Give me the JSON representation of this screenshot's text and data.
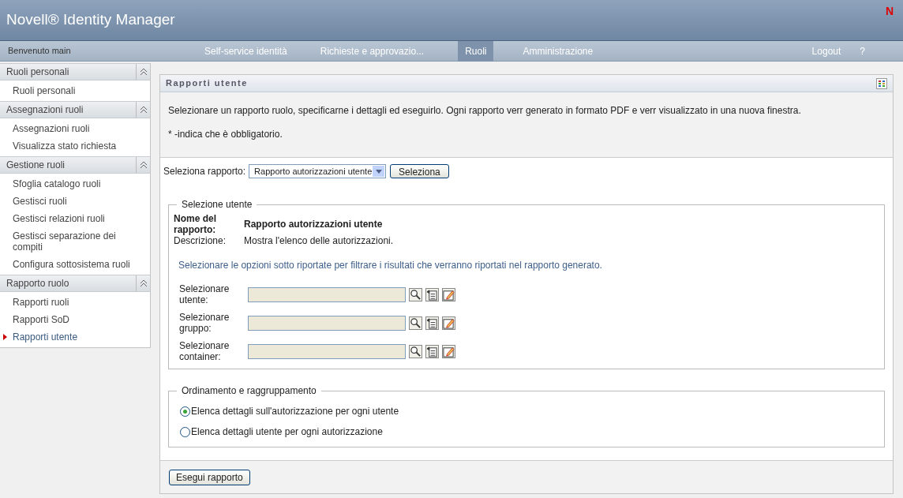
{
  "header": {
    "logo": "Novell® Identity Manager",
    "brand_mark": "N"
  },
  "navbar": {
    "welcome": "Benvenuto main",
    "tabs": [
      {
        "label": "Self-service identità",
        "selected": false
      },
      {
        "label": "Richieste e approvazio...",
        "selected": false
      },
      {
        "label": "Ruoli",
        "selected": true
      },
      {
        "label": "Amministrazione",
        "selected": false
      }
    ],
    "links": [
      "Logout",
      "?"
    ]
  },
  "sidebar": [
    {
      "title": "Ruoli personali",
      "expanded": true,
      "items": [
        {
          "label": "Ruoli personali",
          "selected": false
        }
      ]
    },
    {
      "title": "Assegnazioni ruoli",
      "expanded": true,
      "items": [
        {
          "label": "Assegnazioni ruoli",
          "selected": false
        },
        {
          "label": "Visualizza stato richiesta",
          "selected": false
        }
      ]
    },
    {
      "title": "Gestione ruoli",
      "expanded": true,
      "items": [
        {
          "label": "Sfoglia catalogo ruoli",
          "selected": false
        },
        {
          "label": "Gestisci ruoli",
          "selected": false
        },
        {
          "label": "Gestisci relazioni ruoli",
          "selected": false
        },
        {
          "label": "Gestisci separazione dei compiti",
          "selected": false
        },
        {
          "label": "Configura sottosistema ruoli",
          "selected": false
        }
      ]
    },
    {
      "title": "Rapporto ruolo",
      "expanded": true,
      "items": [
        {
          "label": "Rapporti ruoli",
          "selected": false
        },
        {
          "label": "Rapporti SoD",
          "selected": false
        },
        {
          "label": "Rapporti utente",
          "selected": true
        }
      ]
    }
  ],
  "panel": {
    "title": "Rapporti utente",
    "intro": "Selezionare un rapporto ruolo, specificarne i dettagli ed eseguirlo. Ogni rapporto verr generato in formato PDF e verr visualizzato in una nuova finestra.",
    "required_note": "* -indica che è obbligatorio.",
    "report_select": {
      "label": "Seleziona rapporto:",
      "value": "Rapporto autorizzazioni utente",
      "button": "Seleziona"
    },
    "user_selection": {
      "legend": "Selezione utente",
      "name_label": "Nome del rapporto:",
      "name_value": "Rapporto autorizzazioni utente",
      "desc_label": "Descrizione:",
      "desc_value": "Mostra l'elenco delle autorizzazioni.",
      "hint": "Selezionare le opzioni sotto riportate per filtrare i risultati che verranno riportati nel rapporto generato.",
      "fields": [
        {
          "label": "Selezionare utente:"
        },
        {
          "label": "Selezionare gruppo:"
        },
        {
          "label": "Selezionare container:"
        }
      ]
    },
    "sorting": {
      "legend": "Ordinamento e raggruppamento",
      "options": [
        {
          "label": "Elenca dettagli sull'autorizzazione per ogni utente",
          "selected": true
        },
        {
          "label": "Elenca dettagli utente per ogni autorizzazione",
          "selected": false
        }
      ]
    },
    "run_button": "Esegui rapporto"
  }
}
